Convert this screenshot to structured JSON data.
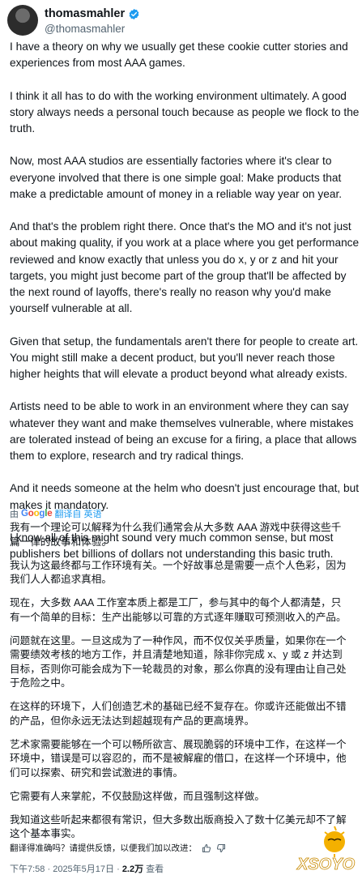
{
  "author": {
    "display_name": "thomasmahler",
    "handle": "@thomasmahler"
  },
  "tweet_paragraphs": [
    [
      "I have a theory on why we usually get these cookie cutter stories and",
      "experiences from most AAA games."
    ],
    [
      "I think it all has to do with the working environment ultimately. A good",
      "story always needs a personal touch because as people we flock to the",
      "truth."
    ],
    [
      "Now, most AAA studios are essentially factories where it's clear to",
      "everyone involved that there is one simple goal: Make products that",
      "make a predictable amount of money in a reliable way year on year."
    ],
    [
      "And that's the problem right there. Once that's the MO and it's not just",
      "about making quality, if you work at a place where you get performance",
      "reviewed and know exactly that unless you do x, y or z and hit your",
      "targets, you might just become part of the group that'll be affected by",
      "the next round of layoffs, there's really no reason why you'd make",
      "yourself vulnerable at all."
    ],
    [
      "Given that setup, the fundamentals aren't there for people to create art.",
      "You might still make a decent product, but you'll never reach those",
      "higher heights that will elevate a product beyond what already exists."
    ],
    [
      "Artists need to be able to work in an environment where they can say",
      "whatever they want and make themselves vulnerable, where mistakes",
      "are tolerated instead of being an excuse for a firing, a place that allows",
      "them to explore, research and try radical things."
    ],
    [
      "And it needs someone at the helm who doesn't just encourage that, but",
      "makes it mandatory."
    ],
    [
      "I know all of this might sound very much common sense, but most",
      "publishers bet billions of dollars not understanding this basic truth."
    ]
  ],
  "translation_bar": {
    "prefix": "由",
    "logo": "Google",
    "suffix": "翻译自 英语"
  },
  "translated_paragraphs": [
    [
      "我有一个理论可以解释为什么我们通常会从大多数 AAA 游戏中获得这些千",
      "篇一律的故事和体验。"
    ],
    [
      "我认为这最终都与工作环境有关。一个好故事总是需要一点个人色彩，因为",
      "我们人人都追求真相。"
    ],
    [
      "现在，大多数 AAA 工作室本质上都是工厂，参与其中的每个人都清楚，只",
      "有一个简单的目标：生产出能够以可靠的方式逐年赚取可预测收入的产品。"
    ],
    [
      "问题就在这里。一旦这成为了一种作风，而不仅仅关乎质量，如果你在一个",
      "需要绩效考核的地方工作，并且清楚地知道，除非你完成 x、y 或 z 并达到",
      "目标，否则你可能会成为下一轮裁员的对象，那么你真的没有理由让自己处",
      "于危险之中。"
    ],
    [
      "在这样的环境下，人们创造艺术的基础已经不复存在。你或许还能做出不错",
      "的产品，但你永远无法达到超越现有产品的更高境界。"
    ],
    [
      "艺术家需要能够在一个可以畅所欲言、展现脆弱的环境中工作，在这样一个",
      "环境中，错误是可以容忍的，而不是被解雇的借口，在这样一个环境中，他",
      "们可以探索、研究和尝试激进的事情。"
    ],
    [
      "它需要有人来掌舵，不仅鼓励这样做，而且强制这样做。"
    ],
    [
      "我知道这些听起来都很有常识，但大多数出版商投入了数十亿美元却不了解",
      "这个基本事实。"
    ]
  ],
  "feedback": {
    "text": "翻译得准确吗？请提供反馈，以便我们加以改进："
  },
  "meta": {
    "time": "下午7:58",
    "sep1": " · ",
    "date": "2025年5月17日",
    "sep2": " · ",
    "views_count": "2.2万",
    "views_label": " 查看"
  },
  "watermark": {
    "text": "XSOYO"
  },
  "colors": {
    "text": "#0f1419",
    "secondary": "#536471",
    "link": "#1d9bf0",
    "verified": "#1d9bf0"
  }
}
